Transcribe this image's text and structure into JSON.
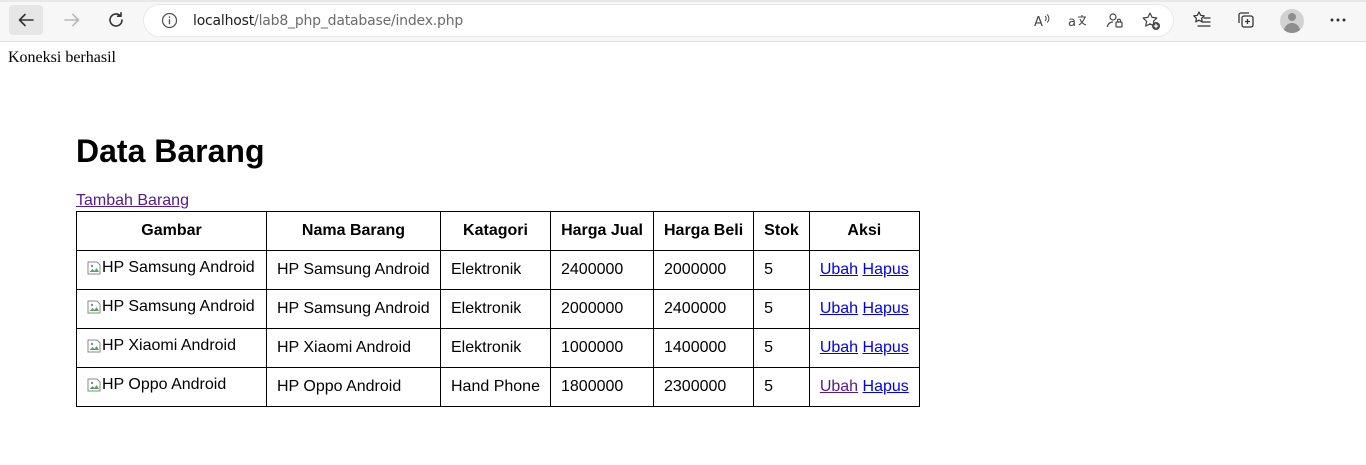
{
  "browser": {
    "url_host": "localhost",
    "url_path": "/lab8_php_database/index.php"
  },
  "page": {
    "status_text": "Koneksi berhasil",
    "heading": "Data Barang",
    "add_link": "Tambah Barang"
  },
  "table": {
    "headers": [
      "Gambar",
      "Nama Barang",
      "Katagori",
      "Harga Jual",
      "Harga Beli",
      "Stok",
      "Aksi"
    ],
    "rows": [
      {
        "img_alt": "HP Samsung Android",
        "nama": "HP Samsung Android",
        "kategori": "Elektronik",
        "harga_jual": "2400000",
        "harga_beli": "2000000",
        "stok": "5",
        "edit": "Ubah",
        "delete": "Hapus"
      },
      {
        "img_alt": "HP Samsung Android",
        "nama": "HP Samsung Android",
        "kategori": "Elektronik",
        "harga_jual": "2000000",
        "harga_beli": "2400000",
        "stok": "5",
        "edit": "Ubah",
        "delete": "Hapus"
      },
      {
        "img_alt": "HP Xiaomi Android",
        "nama": "HP Xiaomi Android",
        "kategori": "Elektronik",
        "harga_jual": "1000000",
        "harga_beli": "1400000",
        "stok": "5",
        "edit": "Ubah",
        "delete": "Hapus"
      },
      {
        "img_alt": "HP Oppo Android",
        "nama": "HP Oppo Android",
        "kategori": "Hand Phone",
        "harga_jual": "1800000",
        "harga_beli": "2300000",
        "stok": "5",
        "edit": "Ubah",
        "delete": "Hapus"
      }
    ]
  }
}
